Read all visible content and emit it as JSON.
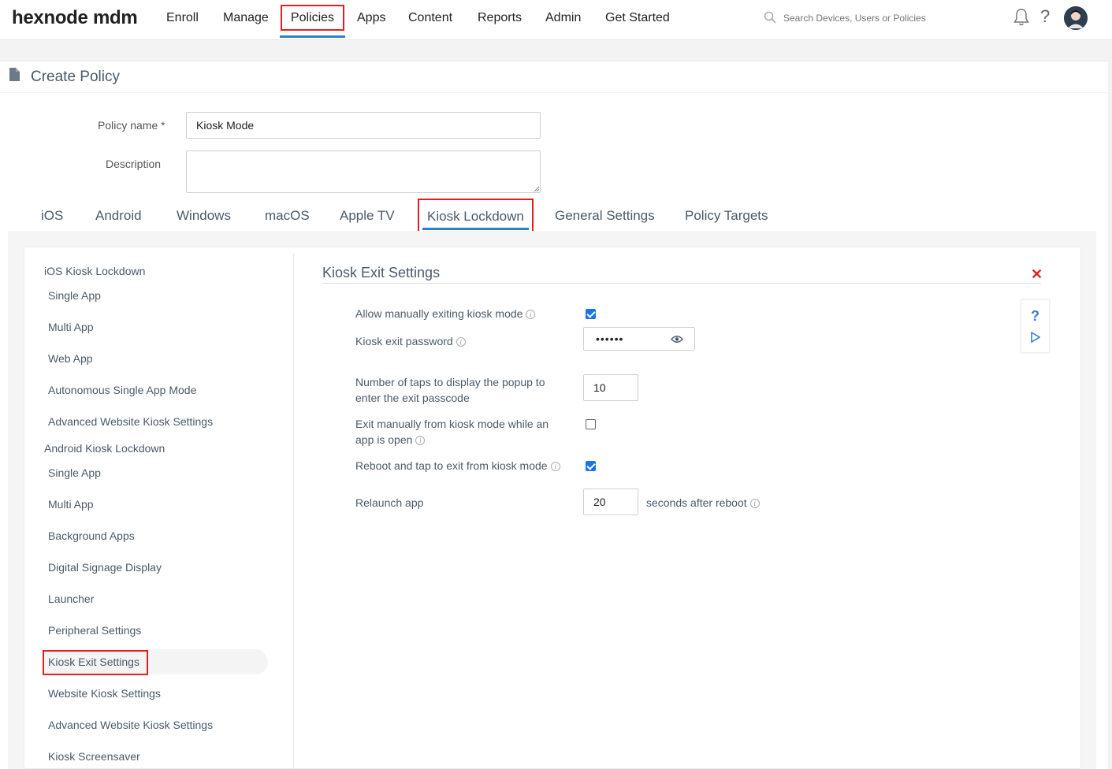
{
  "app": {
    "logo": "hexnode mdm"
  },
  "nav": {
    "items": [
      "Enroll",
      "Manage",
      "Policies",
      "Apps",
      "Content",
      "Reports",
      "Admin",
      "Get Started"
    ],
    "active": "Policies",
    "search_placeholder": "Search Devices, Users or Policies"
  },
  "page": {
    "title": "Create Policy"
  },
  "form": {
    "policy_name_label": "Policy name *",
    "policy_name_value": "Kiosk Mode",
    "description_label": "Description",
    "description_value": ""
  },
  "tabs": {
    "items": [
      "iOS",
      "Android",
      "Windows",
      "macOS",
      "Apple TV",
      "Kiosk Lockdown",
      "General Settings",
      "Policy Targets"
    ],
    "active": "Kiosk Lockdown"
  },
  "sidebar": {
    "groups": [
      {
        "title": "iOS Kiosk Lockdown",
        "items": [
          "Single App",
          "Multi App",
          "Web App",
          "Autonomous Single App Mode",
          "Advanced Website Kiosk Settings"
        ]
      },
      {
        "title": "Android Kiosk Lockdown",
        "items": [
          "Single App",
          "Multi App",
          "Background Apps",
          "Digital Signage Display",
          "Launcher",
          "Peripheral Settings",
          "Kiosk Exit Settings",
          "Website Kiosk Settings",
          "Advanced Website Kiosk Settings",
          "Kiosk Screensaver"
        ]
      }
    ],
    "active": "Kiosk Exit Settings"
  },
  "section": {
    "title": "Kiosk Exit Settings",
    "settings": {
      "allow_exit": {
        "label": "Allow manually exiting kiosk mode",
        "checked": true
      },
      "exit_password": {
        "label": "Kiosk exit password",
        "value": "••••••"
      },
      "taps": {
        "label_line1": "Number of taps to display the popup to",
        "label_line2": "enter the exit passcode",
        "value": "10"
      },
      "exit_app_open": {
        "label_line1": "Exit manually from kiosk mode while an",
        "label_line2": "app is open",
        "checked": false
      },
      "reboot_tap": {
        "label": "Reboot and tap to exit from kiosk mode",
        "checked": true
      },
      "relaunch": {
        "label": "Relaunch app",
        "value": "20",
        "suffix": "seconds after reboot"
      }
    }
  },
  "colors": {
    "accent": "#2f7fd1",
    "highlight": "#e02020",
    "checkbox": "#1a73e8"
  }
}
